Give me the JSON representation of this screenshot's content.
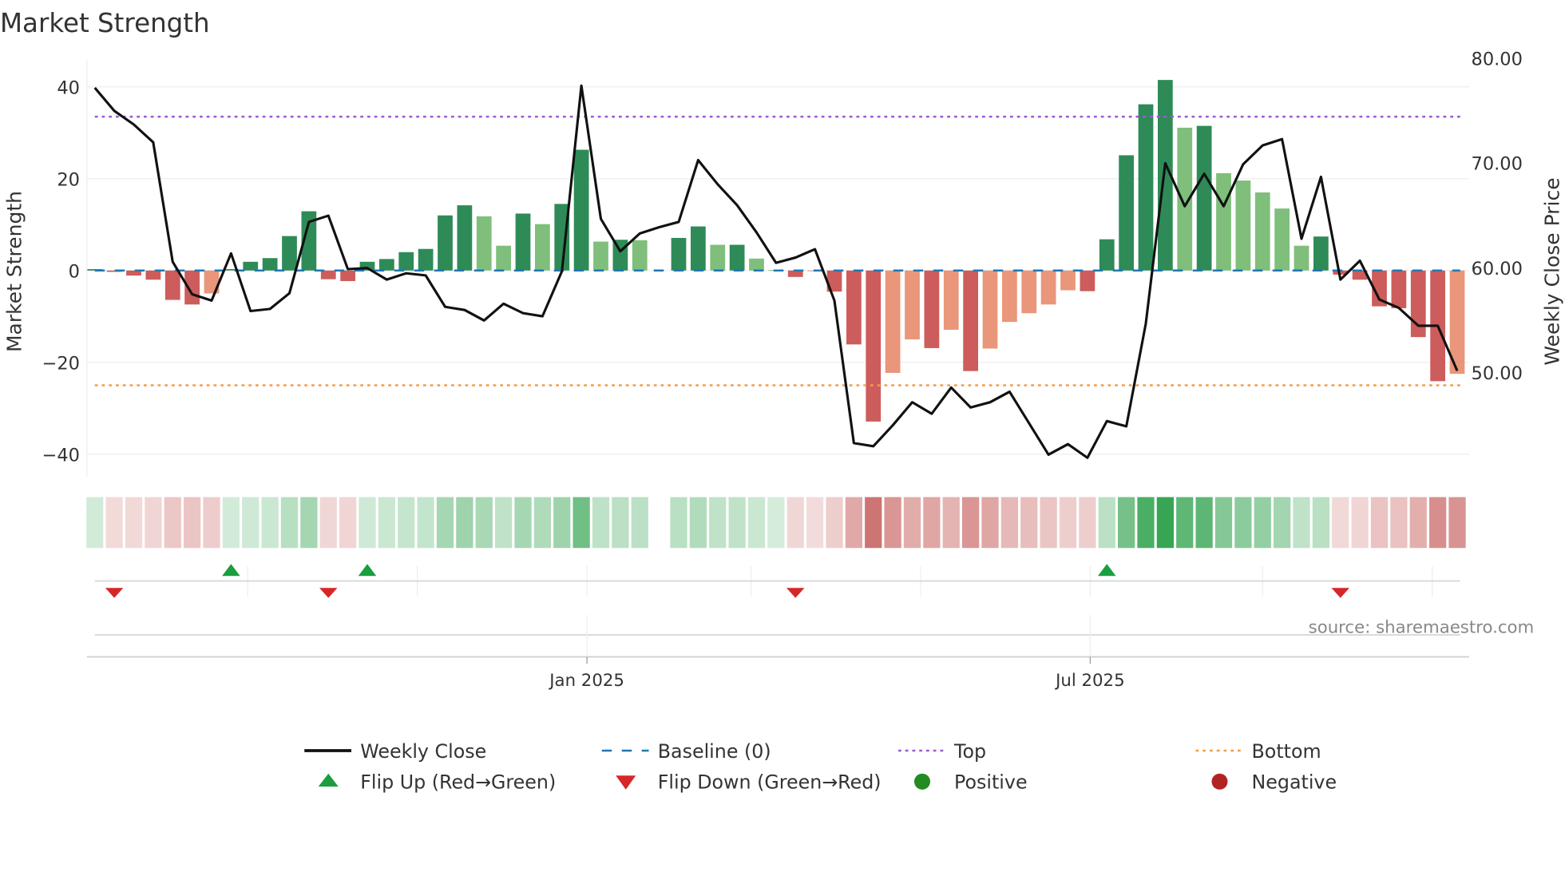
{
  "chart_data": {
    "type": "bar",
    "title": "Market Strength",
    "ylabel": "Market Strength",
    "y2label": "Weekly Close Price",
    "ylim": [
      -45,
      45
    ],
    "y2lim": [
      42,
      80
    ],
    "yticks": [
      40,
      20,
      0,
      -20,
      -40
    ],
    "ytick_labels": [
      "40",
      "20",
      "0",
      "−20",
      "−40"
    ],
    "y2ticks": [
      80,
      70,
      60,
      50
    ],
    "y2tick_labels": [
      "80.00",
      "70.00",
      "60.00",
      "50.00"
    ],
    "xticks": [
      {
        "date": "2025-01-01",
        "label": "Jan 2025"
      },
      {
        "date": "2025-07-01",
        "label": "Jul 2025"
      }
    ],
    "minor_gridlines": [
      "2024-09-01",
      "2024-11-01",
      "2025-01-01",
      "2025-03-01",
      "2025-05-01",
      "2025-07-01",
      "2025-09-01",
      "2025-11-01"
    ],
    "x_start": "2024-07-08",
    "x_interval": "weekly",
    "grid": true,
    "legend_position": "bottom-center",
    "top_level": 33.5,
    "bottom_level": -25,
    "baseline": 0,
    "strength": [
      0.3,
      -0.3,
      -1.1,
      -2.0,
      -6.4,
      -7.4,
      -5.0,
      0.3,
      1.9,
      2.7,
      7.5,
      12.9,
      -1.9,
      -2.3,
      1.9,
      2.5,
      4.0,
      4.7,
      12.0,
      14.2,
      11.8,
      5.4,
      12.4,
      10.1,
      14.5,
      26.3,
      6.3,
      6.7,
      6.6,
      null,
      7.1,
      9.6,
      5.6,
      5.6,
      2.6,
      0.1,
      -1.4,
      -0.1,
      -4.6,
      -16.1,
      -32.9,
      -22.3,
      -15.0,
      -16.9,
      -12.9,
      -21.9,
      -17.0,
      -11.2,
      -9.3,
      -7.4,
      -4.3,
      -4.5,
      6.8,
      25.1,
      36.2,
      41.5,
      31.1,
      31.5,
      21.2,
      19.6,
      17.0,
      13.5,
      5.4,
      7.4,
      -0.9,
      -2.0,
      -7.8,
      -8.2,
      -14.5,
      -24.1,
      -22.5
    ],
    "weekly_close": [
      78.1,
      75.9,
      74.6,
      72.9,
      61.5,
      58.4,
      57.8,
      62.3,
      56.8,
      57.0,
      58.5,
      65.3,
      65.9,
      60.8,
      60.9,
      59.8,
      60.4,
      60.2,
      57.2,
      56.9,
      55.9,
      57.5,
      56.6,
      56.3,
      60.6,
      78.3,
      65.6,
      62.5,
      64.2,
      64.8,
      65.3,
      71.2,
      68.9,
      66.9,
      64.3,
      61.4,
      61.9,
      62.7,
      57.8,
      44.2,
      43.9,
      45.9,
      48.1,
      47.0,
      49.5,
      47.6,
      48.1,
      49.1,
      46.1,
      43.1,
      44.1,
      42.8,
      46.3,
      45.8,
      55.6,
      70.9,
      66.8,
      69.9,
      66.8,
      70.8,
      72.6,
      73.2,
      63.7,
      69.6,
      59.8,
      61.6,
      57.9,
      57.1,
      55.4,
      55.4,
      51.1
    ],
    "flip_up_indices": [
      7,
      14,
      52
    ],
    "flip_down_indices": [
      1,
      12,
      36,
      64
    ],
    "legend": [
      {
        "key": "close",
        "label": "Weekly Close"
      },
      {
        "key": "baseline",
        "label": "Baseline (0)"
      },
      {
        "key": "top",
        "label": "Top"
      },
      {
        "key": "bottom",
        "label": "Bottom"
      },
      {
        "key": "flip_up",
        "label": "Flip Up (Red→Green)"
      },
      {
        "key": "flip_down",
        "label": "Flip Down (Green→Red)"
      },
      {
        "key": "positive",
        "label": "Positive"
      },
      {
        "key": "negative",
        "label": "Negative"
      }
    ],
    "colors": {
      "strong_pos": "#2e8b57",
      "weak_pos": "#7fbf7b",
      "strong_neg": "#cd5c5c",
      "weak_neg": "#e9967a",
      "heat_pos": "#2ca04a",
      "heat_neg": "#c0504d",
      "close": "#111111",
      "baseline": "#1f77b4",
      "top": "#9b59d6",
      "bottom": "#f39c4a",
      "flip_up": "#1a9e3f",
      "flip_down": "#d62728",
      "positive": "#228b22",
      "negative": "#b22222"
    }
  },
  "source": "source: sharemaestro.com"
}
